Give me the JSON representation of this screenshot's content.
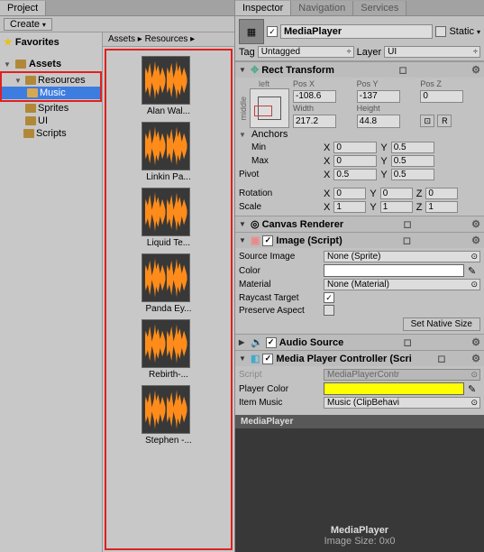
{
  "project": {
    "tab": "Project",
    "create": "Create",
    "favorites": "Favorites",
    "assets_root": "Assets",
    "tree": {
      "resources": "Resources",
      "music": "Music",
      "sprites": "Sprites",
      "ui": "UI",
      "scripts": "Scripts"
    },
    "breadcrumb": "Assets  ▸  Resources  ▸",
    "assets": [
      {
        "label": "Alan Wal..."
      },
      {
        "label": "Linkin Pa..."
      },
      {
        "label": "Liquid Te..."
      },
      {
        "label": "Panda Ey..."
      },
      {
        "label": "Rebirth-..."
      },
      {
        "label": "Stephen -..."
      }
    ]
  },
  "inspector": {
    "tabs": {
      "inspector": "Inspector",
      "nav": "Navigation",
      "services": "Services"
    },
    "object_name": "MediaPlayer",
    "static": "Static",
    "tag_label": "Tag",
    "tag_value": "Untagged",
    "layer_label": "Layer",
    "layer_value": "UI",
    "rect": {
      "title": "Rect Transform",
      "anchor_h": "left",
      "anchor_v": "middle",
      "posx_l": "Pos X",
      "posy_l": "Pos Y",
      "posz_l": "Pos Z",
      "posx": "-108.6",
      "posy": "-137",
      "posz": "0",
      "w_l": "Width",
      "h_l": "Height",
      "w": "217.2",
      "h": "44.8",
      "r_btn": "R",
      "anchors": "Anchors",
      "min": "Min",
      "min_x": "0",
      "min_y": "0.5",
      "max": "Max",
      "max_x": "0",
      "max_y": "0.5",
      "pivot": "Pivot",
      "pivot_x": "0.5",
      "pivot_y": "0.5",
      "rotation": "Rotation",
      "rx": "0",
      "ry": "0",
      "rz": "0",
      "scale": "Scale",
      "sx": "1",
      "sy": "1",
      "sz": "1"
    },
    "canvas": {
      "title": "Canvas Renderer"
    },
    "image": {
      "title": "Image (Script)",
      "source_l": "Source Image",
      "source": "None (Sprite)",
      "color_l": "Color",
      "material_l": "Material",
      "material": "None (Material)",
      "raycast_l": "Raycast Target",
      "preserve_l": "Preserve Aspect",
      "set_native": "Set Native Size"
    },
    "audio": {
      "title": "Audio Source"
    },
    "mpc": {
      "title": "Media Player Controller (Scri",
      "script_l": "Script",
      "script": "MediaPlayerContr",
      "player_color_l": "Player Color",
      "item_music_l": "Item Music",
      "item_music": "Music (ClipBehavi"
    },
    "preview": {
      "title": "MediaPlayer",
      "name": "MediaPlayer",
      "size": "Image Size: 0x0"
    }
  }
}
